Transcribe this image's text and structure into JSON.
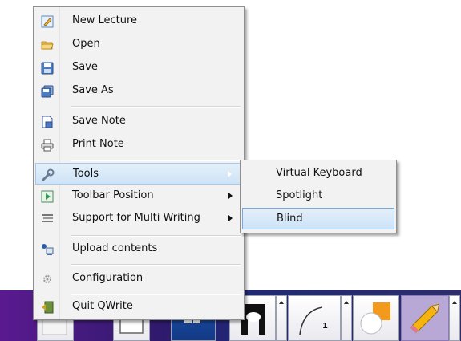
{
  "menu": {
    "items": [
      {
        "label": "New Lecture",
        "icon": "new-lecture-icon"
      },
      {
        "label": "Open",
        "icon": "open-folder-icon"
      },
      {
        "label": "Save",
        "icon": "save-icon"
      },
      {
        "label": "Save As",
        "icon": "save-as-icon"
      },
      {
        "label": "Save Note",
        "icon": "save-note-icon"
      },
      {
        "label": "Print Note",
        "icon": "print-icon"
      },
      {
        "label": "Tools",
        "icon": "wrench-icon",
        "has_submenu": true,
        "active": true
      },
      {
        "label": "Toolbar Position",
        "icon": "toolbar-position-icon",
        "has_submenu": true
      },
      {
        "label": "Support for Multi Writing",
        "icon": "multi-writing-icon",
        "has_submenu": true
      },
      {
        "label": "Upload contents",
        "icon": "upload-icon"
      },
      {
        "label": "Configuration",
        "icon": "gear-icon"
      },
      {
        "label": "Quit QWrite",
        "icon": "exit-icon"
      }
    ]
  },
  "submenu": {
    "parent": "Tools",
    "items": [
      {
        "label": "Virtual Keyboard"
      },
      {
        "label": "Spotlight"
      },
      {
        "label": "Blind",
        "highlighted": true
      }
    ]
  },
  "toolbar": {
    "tools": [
      {
        "icon": "page-icon"
      },
      {
        "icon": "windows-icon"
      },
      {
        "icon": "pen-tip-icon"
      },
      {
        "icon": "stroke-width-icon",
        "value": "1"
      },
      {
        "icon": "shape-icon"
      },
      {
        "icon": "pencil-icon",
        "active": true
      }
    ]
  },
  "colors": {
    "highlight": "#cde3f6",
    "highlight_border": "#7ba9d9",
    "taskbar": "#2f1a6d",
    "accent_orange": "#f39a1c"
  }
}
